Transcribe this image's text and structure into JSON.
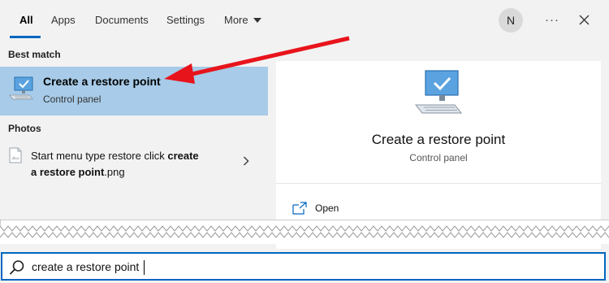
{
  "tabs": [
    {
      "label": "All",
      "active": true
    },
    {
      "label": "Apps"
    },
    {
      "label": "Documents"
    },
    {
      "label": "Settings"
    },
    {
      "label": "More"
    }
  ],
  "user": {
    "initial": "N"
  },
  "more_options": "···",
  "best_match": {
    "section_title": "Best match",
    "title": "Create a restore point",
    "subtitle": "Control panel",
    "icon": "computer-check-icon"
  },
  "photos": {
    "section_title": "Photos",
    "item_text_plain": "Start menu type restore click ",
    "item_text_bold1": "create",
    "item_text_bold2": "a restore point",
    "item_text_ext": ".png",
    "icon": "image-file-icon"
  },
  "preview": {
    "title": "Create a restore point",
    "subtitle": "Control panel",
    "actions": [
      {
        "label": "Open",
        "icon": "open-window-icon"
      }
    ]
  },
  "search": {
    "value": "create a restore point",
    "icon": "search-icon"
  },
  "colors": {
    "accent": "#0067c0",
    "selection": "#a7cbe8",
    "annotation_arrow": "#e8141c",
    "pane_bg": "#f2f2f2"
  }
}
